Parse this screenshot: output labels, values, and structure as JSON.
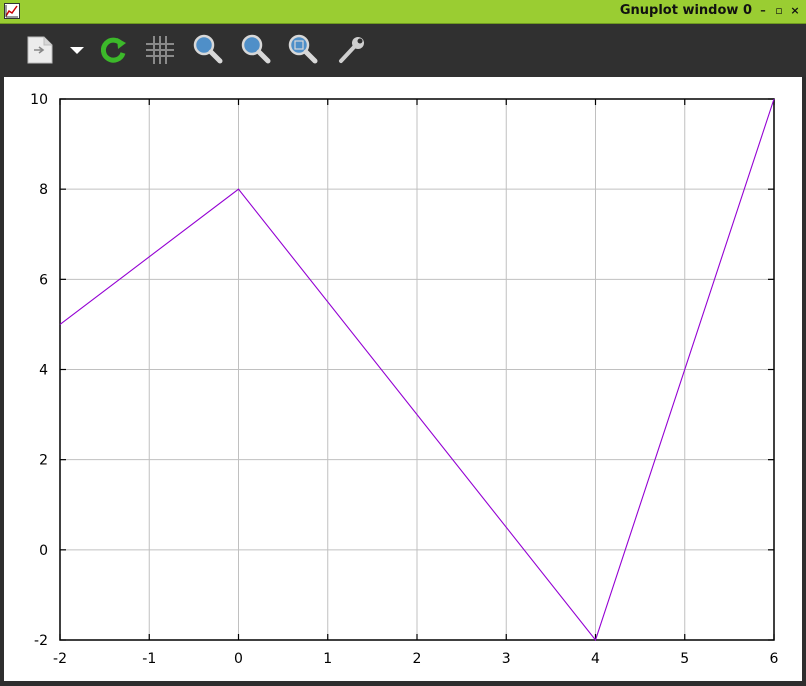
{
  "window": {
    "title": "Gnuplot window 0",
    "buttons": {
      "minimize": "–",
      "restore": "▫",
      "close": "×"
    }
  },
  "toolbar": {
    "items": [
      {
        "name": "export-icon"
      },
      {
        "name": "export-dropdown-icon"
      },
      {
        "name": "replot-icon"
      },
      {
        "name": "grid-icon"
      },
      {
        "name": "zoom-previous-icon"
      },
      {
        "name": "zoom-next-icon"
      },
      {
        "name": "autoscale-icon"
      },
      {
        "name": "settings-icon"
      }
    ]
  },
  "colors": {
    "titlebar": "#9acd32",
    "series": "#9400d3",
    "grid": "#c0c0c0"
  },
  "chart_data": {
    "type": "line",
    "title": "",
    "xlabel": "",
    "ylabel": "",
    "xlim": [
      -2,
      6
    ],
    "ylim": [
      -2,
      10
    ],
    "grid": true,
    "legend": "none",
    "x_ticks": [
      "-2",
      "-1",
      "0",
      "1",
      "2",
      "3",
      "4",
      "5",
      "6"
    ],
    "y_ticks": [
      "-2",
      "0",
      "2",
      "4",
      "6",
      "8",
      "10"
    ],
    "series": [
      {
        "x": [
          -2,
          0,
          4,
          6
        ],
        "y": [
          5,
          8,
          -2,
          10
        ]
      }
    ]
  }
}
